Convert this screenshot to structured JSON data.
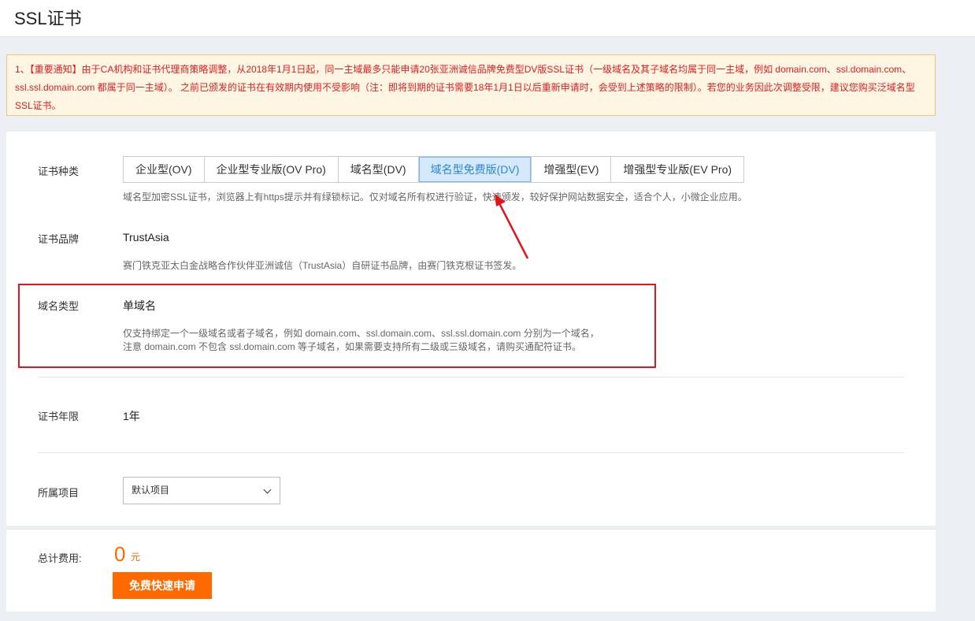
{
  "header": {
    "title": "SSL证书"
  },
  "notice": {
    "text": "1、【重要通知】由于CA机构和证书代理商策略调整，从2018年1月1日起，同一主域最多只能申请20张亚洲诚信品牌免费型DV版SSL证书（一级域名及其子域名均属于同一主域，例如 domain.com、ssl.domain.com、ssl.ssl.domain.com 都属于同一主域）。 之前已颁发的证书在有效期内使用不受影响（注：即将到期的证书需要18年1月1日以后重新申请时，会受到上述策略的限制）。若您的业务因此次调整受限，建议您购买泛域名型SSL证书。"
  },
  "cert_type": {
    "label": "证书种类",
    "tabs": [
      {
        "label": "企业型(OV)",
        "active": false
      },
      {
        "label": "企业型专业版(OV Pro)",
        "active": false
      },
      {
        "label": "域名型(DV)",
        "active": false
      },
      {
        "label": "域名型免费版(DV)",
        "active": true
      },
      {
        "label": "增强型(EV)",
        "active": false
      },
      {
        "label": "增强型专业版(EV Pro)",
        "active": false
      }
    ],
    "hint": "域名型加密SSL证书，浏览器上有https提示并有绿锁标记。仅对域名所有权进行验证，快速颁发，较好保护网站数据安全，适合个人，小微企业应用。"
  },
  "brand": {
    "label": "证书品牌",
    "value": "TrustAsia",
    "hint": "赛门铁克亚太白金战略合作伙伴亚洲诚信（TrustAsia）自研证书品牌，由赛门铁克根证书签发。"
  },
  "domain_type": {
    "label": "域名类型",
    "value": "单域名",
    "hint_line1": "仅支持绑定一个一级域名或者子域名，例如 domain.com、ssl.domain.com、ssl.ssl.domain.com 分别为一个域名，",
    "hint_line2": "注意 domain.com 不包含 ssl.domain.com 等子域名，如果需要支持所有二级或三级域名，请购买通配符证书。"
  },
  "period": {
    "label": "证书年限",
    "value": "1年"
  },
  "project": {
    "label": "所属项目",
    "selected": "默认项目"
  },
  "footer": {
    "total_label": "总计费用:",
    "price": "0",
    "currency": "元",
    "apply_label": "免费快速申请"
  },
  "colors": {
    "accent": "#ff6a00",
    "notice_text": "#e02020",
    "active_tab": "#2b88d8",
    "highlight": "#e0161c"
  }
}
